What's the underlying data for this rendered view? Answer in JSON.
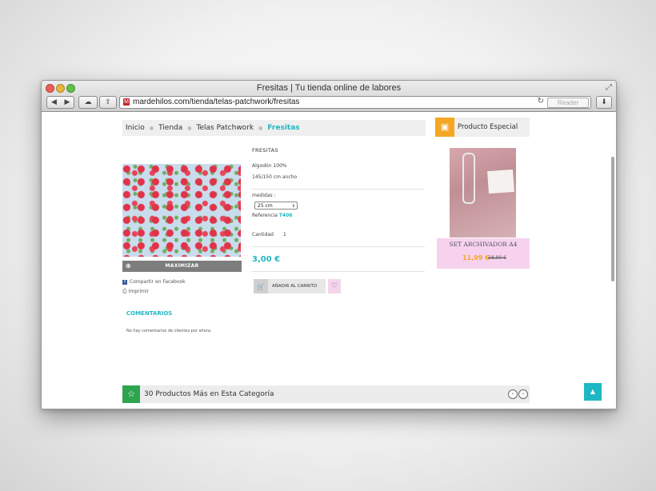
{
  "window": {
    "title": "Fresitas | Tu tienda online de labores",
    "url": "mardehilos.com/tienda/telas-patchwork/fresitas",
    "reader_label": "Reader"
  },
  "breadcrumb": {
    "items": [
      "Inicio",
      "Tienda",
      "Telas Patchwork"
    ],
    "current": "Fresitas"
  },
  "product": {
    "title": "FRESITAS",
    "composition": "Algodón 100%",
    "width": "145/150 cm ancho",
    "medidas_label": "medidas :",
    "medidas_value": "25 cm",
    "reference_label": "Referencia",
    "reference_value": "T406",
    "quantity_label": "Cantidad",
    "quantity_value": "1",
    "price": "3,00 €",
    "add_to_cart": "AÑADIR AL CARRITO",
    "zoom_label": "MAXIMIZAR",
    "share_facebook": "Compartir en Facebook",
    "print": "Imprimir"
  },
  "comments": {
    "title": "COMENTARIOS",
    "empty": "No hay comentarios de clientes por ahora."
  },
  "special": {
    "title": "Producto Especial",
    "name": "SET ARCHIVADOR A4",
    "price": "11,99 €",
    "old_price": "18,90 €"
  },
  "more_products": {
    "title": "30 Productos Más en Esta Categoría"
  },
  "colors": {
    "accent": "#1fb7c4",
    "special_orange": "#f5a623",
    "star_green": "#2ea44f",
    "pink": "#f7d2ef"
  }
}
